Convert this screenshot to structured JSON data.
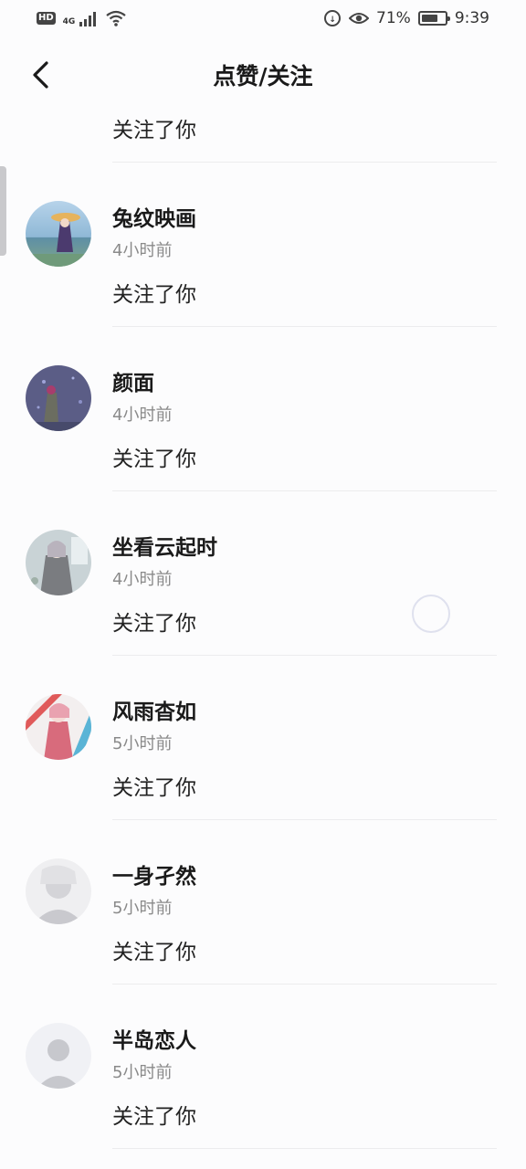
{
  "status_bar": {
    "hd": "HD",
    "network": "4G",
    "battery": "71%",
    "battery_level": 0.71,
    "time": "9:39"
  },
  "header": {
    "title": "点赞/关注",
    "back_icon": "chevron-left-icon"
  },
  "notifications": [
    {
      "name": "",
      "time": "",
      "action": "关注了你",
      "avatar": "partial"
    },
    {
      "name": "兔纹映画",
      "time": "4小时前",
      "action": "关注了你",
      "avatar": "seaside"
    },
    {
      "name": "颜面",
      "time": "4小时前",
      "action": "关注了你",
      "avatar": "night"
    },
    {
      "name": "坐看云起时",
      "time": "4小时前",
      "action": "关注了你",
      "avatar": "grey"
    },
    {
      "name": "风雨杳如",
      "time": "5小时前",
      "action": "关注了你",
      "avatar": "pink"
    },
    {
      "name": "一身孑然",
      "time": "5小时前",
      "action": "关注了你",
      "avatar": "faded"
    },
    {
      "name": "半岛恋人",
      "time": "5小时前",
      "action": "关注了你",
      "avatar": "default"
    }
  ],
  "colors": {
    "background": "#fcfcfd",
    "name_text": "#1a1a1a",
    "time_text": "#8a8a8a",
    "divider": "#ececee"
  }
}
